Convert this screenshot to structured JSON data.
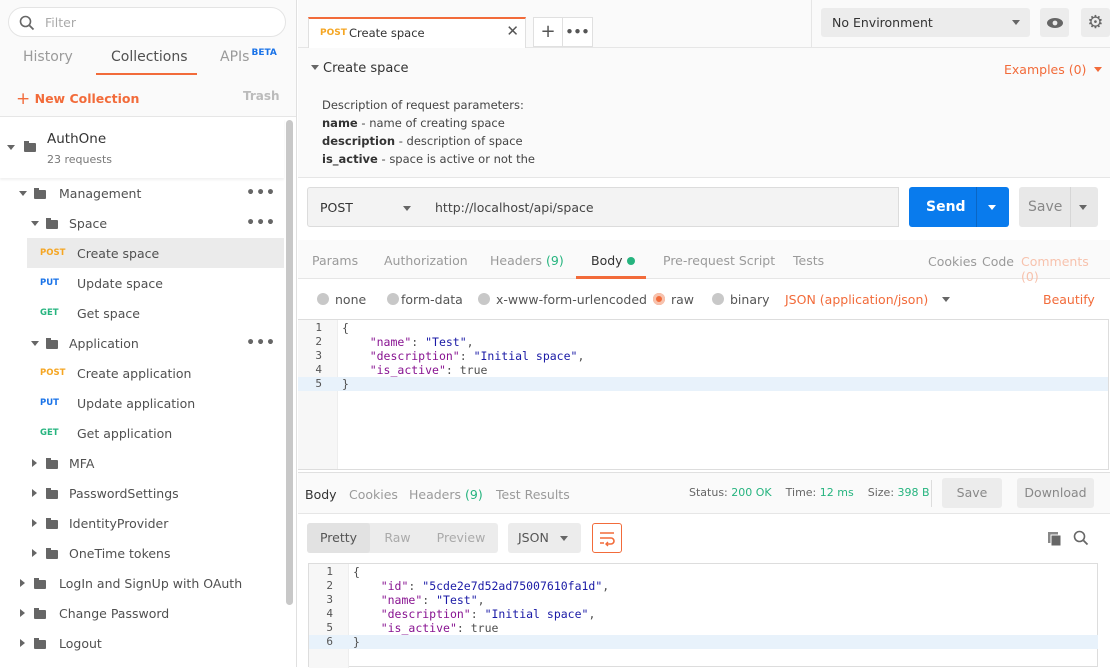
{
  "sidebar": {
    "filter_placeholder": "Filter",
    "tabs": [
      {
        "label": "History"
      },
      {
        "label": "Collections"
      },
      {
        "label": "APIs"
      }
    ],
    "beta_badge": "BETA",
    "new_collection": "New Collection",
    "trash": "Trash",
    "collection": {
      "name": "AuthOne",
      "count": "23 requests"
    },
    "tree": [
      {
        "type": "folder",
        "level": 1,
        "open": true,
        "label": "Management",
        "more": true
      },
      {
        "type": "folder",
        "level": 2,
        "open": true,
        "label": "Space",
        "more": true
      },
      {
        "type": "request",
        "method": "POST",
        "label": "Create space",
        "selected": true
      },
      {
        "type": "request",
        "method": "PUT",
        "label": "Update space"
      },
      {
        "type": "request",
        "method": "GET",
        "label": "Get space"
      },
      {
        "type": "folder",
        "level": 2,
        "open": true,
        "label": "Application",
        "more": true
      },
      {
        "type": "request",
        "method": "POST",
        "label": "Create application"
      },
      {
        "type": "request",
        "method": "PUT",
        "label": "Update application"
      },
      {
        "type": "request",
        "method": "GET",
        "label": "Get application"
      },
      {
        "type": "folder",
        "level": 2,
        "open": false,
        "label": "MFA"
      },
      {
        "type": "folder",
        "level": 2,
        "open": false,
        "label": "PasswordSettings"
      },
      {
        "type": "folder",
        "level": 2,
        "open": false,
        "label": "IdentityProvider"
      },
      {
        "type": "folder",
        "level": 2,
        "open": false,
        "label": "OneTime tokens"
      },
      {
        "type": "folder",
        "level": 1,
        "open": false,
        "label": "LogIn and SignUp with OAuth"
      },
      {
        "type": "folder",
        "level": 1,
        "open": false,
        "label": "Change Password"
      },
      {
        "type": "folder",
        "level": 1,
        "open": false,
        "label": "Logout"
      }
    ]
  },
  "colors": {
    "accent": "#f26b3a",
    "post": "#f5a623",
    "put": "#1a73e8",
    "get": "#26b47f",
    "send": "#097bed",
    "success": "#26b47f"
  },
  "request_tab": {
    "method": "POST",
    "title": "Create space"
  },
  "environment": {
    "selected": "No Environment"
  },
  "request": {
    "name": "Create space",
    "examples": "Examples (0)",
    "description": [
      {
        "bold": "",
        "text": "Description of request parameters:"
      },
      {
        "bold": "name",
        "text": " - name of creating space"
      },
      {
        "bold": "description",
        "text": " - description of space"
      },
      {
        "bold": "is_active",
        "text": " - space is active or not the"
      }
    ],
    "method": "POST",
    "url": "http://localhost/api/space",
    "send": "Send",
    "save": "Save",
    "tabs": {
      "params": "Params",
      "authorization": "Authorization",
      "headers": "Headers",
      "headers_count": "(9)",
      "body": "Body",
      "prerequest": "Pre-request Script",
      "tests": "Tests"
    },
    "links": {
      "cookies": "Cookies",
      "code": "Code",
      "comments": "Comments (0)"
    },
    "body_modes": [
      "none",
      "form-data",
      "x-www-form-urlencoded",
      "raw",
      "binary"
    ],
    "body_mode_selected": "raw",
    "content_type": "JSON (application/json)",
    "beautify": "Beautify",
    "body_lines": [
      "{",
      "    \"name\": \"Test\",",
      "    \"description\": \"Initial space\",",
      "    \"is_active\": true",
      "}"
    ]
  },
  "response": {
    "tabs": {
      "body": "Body",
      "cookies": "Cookies",
      "headers": "Headers",
      "headers_count": "(9)",
      "tests": "Test Results"
    },
    "status_label": "Status:",
    "status": "200 OK",
    "time_label": "Time:",
    "time": "12 ms",
    "size_label": "Size:",
    "size": "398 B",
    "save": "Save",
    "download": "Download",
    "views": [
      "Pretty",
      "Raw",
      "Preview"
    ],
    "format": "JSON",
    "body_lines": [
      "{",
      "    \"id\": \"5cde2e7d52ad75007610fa1d\",",
      "    \"name\": \"Test\",",
      "    \"description\": \"Initial space\",",
      "    \"is_active\": true",
      "}"
    ]
  }
}
